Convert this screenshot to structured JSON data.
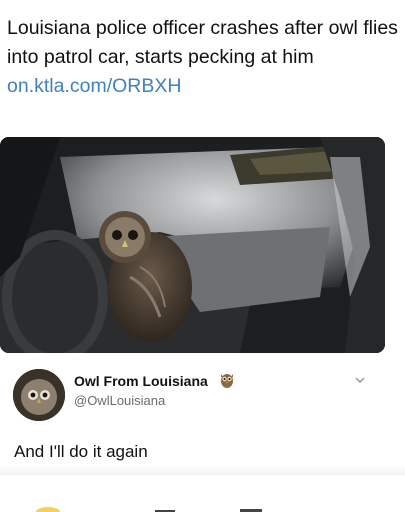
{
  "post": {
    "headline": "Louisiana police officer crashes after owl flies into patrol car, starts pecking at him",
    "link": "on.ktla.com/ORBXH"
  },
  "reply": {
    "display_name": "Owl From Louisiana",
    "handle": "@OwlLouisiana",
    "text": "And I'll do it again"
  },
  "colors": {
    "link": "#3f82bf",
    "handle": "#6b6b6b"
  },
  "icons": {
    "badge": "owl-emoji-icon",
    "menu": "chevron-down-icon"
  }
}
